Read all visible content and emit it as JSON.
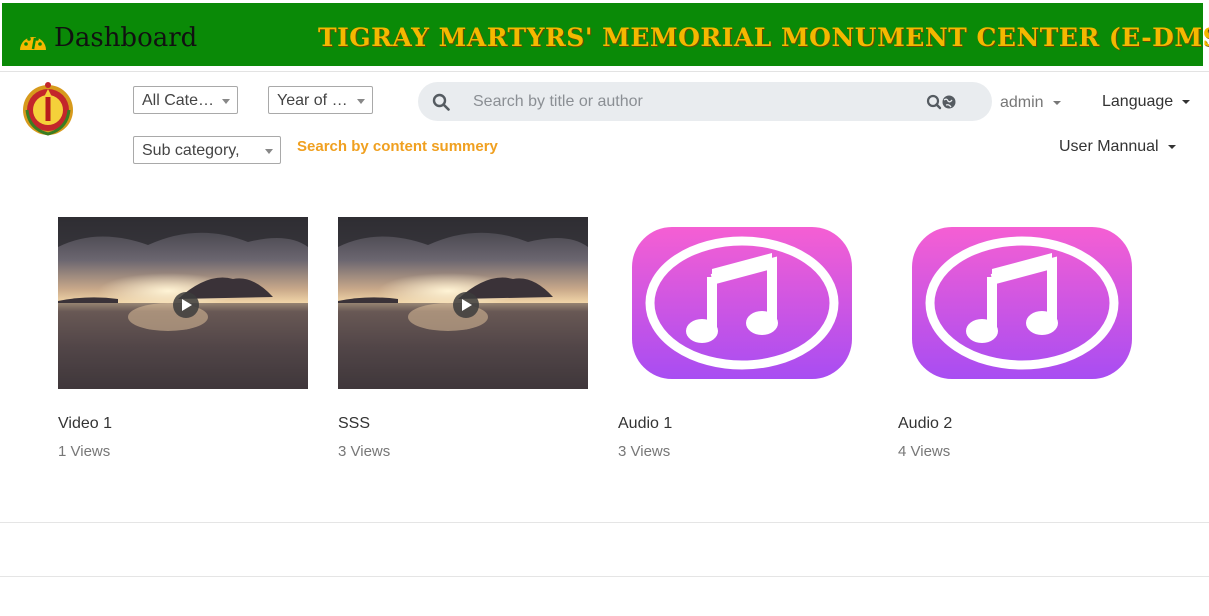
{
  "header": {
    "dashboard_label": "Dashboard",
    "site_title": "TIGRAY MARTYRS' MEMORIAL MONUMENT CENTER (E-DMS)",
    "background_color": "#0a8a07",
    "title_color": "#f5b800"
  },
  "filters": {
    "category": {
      "selected": "All Cate…"
    },
    "year": {
      "selected": "Year of …"
    },
    "subcategory": {
      "selected": "Sub category,"
    }
  },
  "search": {
    "placeholder": "Search by title or author",
    "value": "",
    "icon": "search-icon",
    "advanced_icon": "advanced-search-icon"
  },
  "summary_search_link": "Search by content summery",
  "user_menu": {
    "admin_label": "admin",
    "language_label": "Language",
    "manual_label": "User Mannual"
  },
  "media_items": [
    {
      "title": "Video 1",
      "views": "1 Views",
      "kind": "video"
    },
    {
      "title": "SSS",
      "views": "3 Views",
      "kind": "video"
    },
    {
      "title": "Audio 1",
      "views": "3 Views",
      "kind": "audio"
    },
    {
      "title": "Audio 2",
      "views": "4 Views",
      "kind": "audio"
    }
  ],
  "colors": {
    "accent_orange": "#f0a020",
    "audio_gradient_top": "#f55fd3",
    "audio_gradient_bottom": "#a84df2"
  }
}
